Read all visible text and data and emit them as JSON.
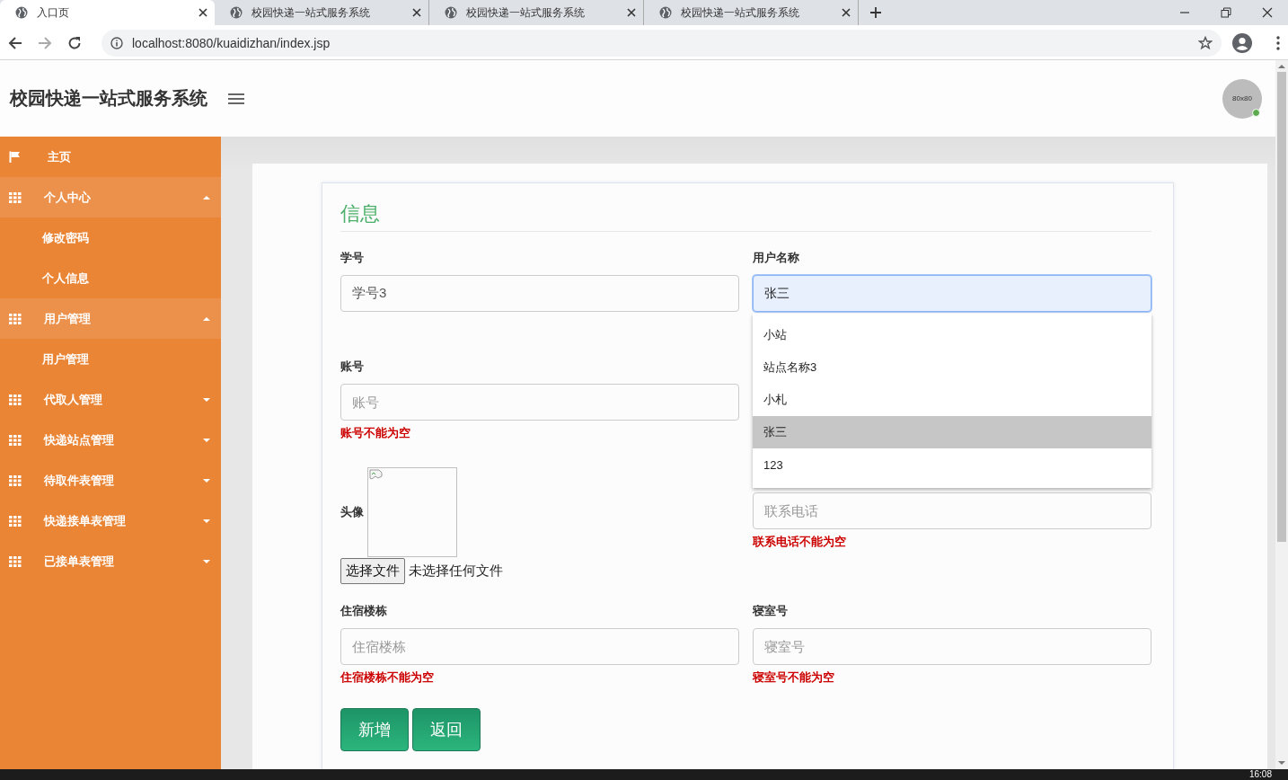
{
  "browser": {
    "tabs": [
      {
        "title": "入口页",
        "selected": true
      },
      {
        "title": "校园快递一站式服务系统",
        "selected": false
      },
      {
        "title": "校园快递一站式服务系统",
        "selected": false
      },
      {
        "title": "校园快递一站式服务系统",
        "selected": false
      }
    ],
    "url": "localhost:8080/kuaidizhan/index.jsp"
  },
  "header": {
    "title": "校园快递一站式服务系统",
    "avatar": {
      "label": "80x80",
      "online": true
    }
  },
  "sidebar": {
    "items": [
      {
        "label": "主页",
        "kind": "link"
      },
      {
        "label": "个人中心",
        "kind": "group",
        "expanded": true,
        "children": [
          {
            "label": "修改密码"
          },
          {
            "label": "个人信息"
          }
        ]
      },
      {
        "label": "用户管理",
        "kind": "group",
        "expanded": true,
        "children": [
          {
            "label": "用户管理"
          }
        ]
      },
      {
        "label": "代取人管理",
        "kind": "group",
        "expanded": false
      },
      {
        "label": "快递站点管理",
        "kind": "group",
        "expanded": false
      },
      {
        "label": "待取件表管理",
        "kind": "group",
        "expanded": false
      },
      {
        "label": "快递接单表管理",
        "kind": "group",
        "expanded": false
      },
      {
        "label": "已接单表管理",
        "kind": "group",
        "expanded": false
      }
    ]
  },
  "form": {
    "heading": "信息",
    "groups": [
      {
        "left": [
          {
            "kind": "text",
            "label": "学号",
            "value": "学号3"
          },
          {
            "kind": "text",
            "label": "账号",
            "placeholder": "账号",
            "error": "账号不能为空"
          },
          {
            "kind": "image",
            "label": "头像",
            "button": "选择文件",
            "file_status": "未选择任何文件"
          }
        ],
        "right": [
          {
            "kind": "select",
            "label": "用户名称",
            "value": "张三",
            "open": true,
            "options": [
              {
                "label": "小站",
                "selected": false
              },
              {
                "label": "站点名称3",
                "selected": false
              },
              {
                "label": "小札",
                "selected": false
              },
              {
                "label": "张三",
                "selected": true
              },
              {
                "label": "123",
                "selected": false
              }
            ]
          },
          {
            "kind": "covered"
          },
          {
            "kind": "text",
            "placeholder": "联系电话",
            "error": "联系电话不能为空"
          }
        ]
      },
      {
        "left": [
          {
            "kind": "text",
            "label": "住宿楼栋",
            "placeholder": "住宿楼栋",
            "error": "住宿楼栋不能为空"
          }
        ],
        "right": [
          {
            "kind": "text",
            "label": "寝室号",
            "placeholder": "寝室号",
            "error": "寝室号不能为空"
          }
        ]
      }
    ],
    "buttons": [
      "新增",
      "返回"
    ]
  },
  "taskbar": {
    "clock": "16:08"
  }
}
